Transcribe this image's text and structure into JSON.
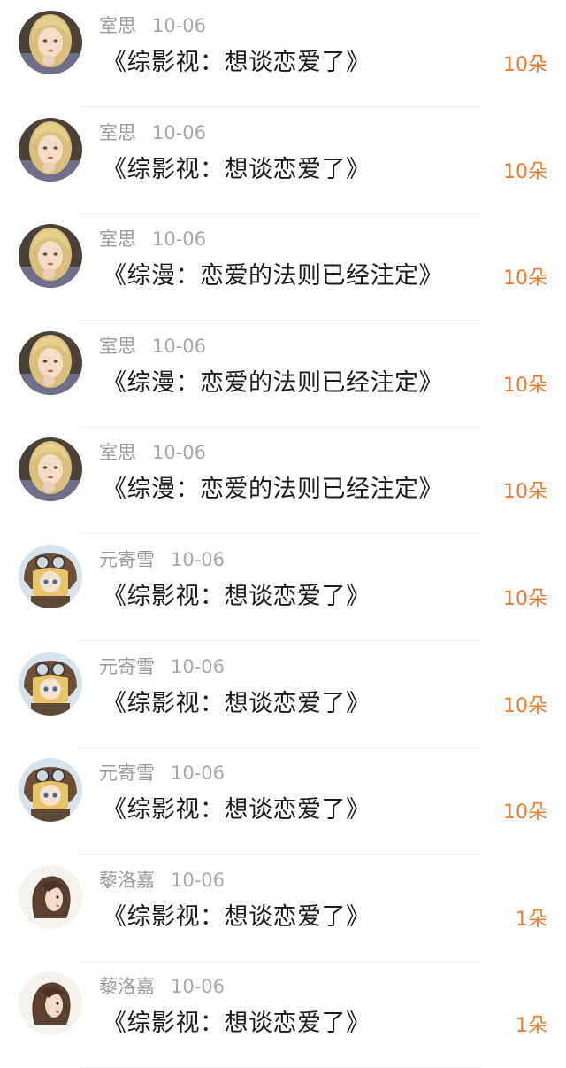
{
  "list": [
    {
      "name": "室思",
      "date": "10-06",
      "title": "《综影视：想谈恋爱了》",
      "gift": "10朵",
      "avatar": "blonde-girl-avatar"
    },
    {
      "name": "室思",
      "date": "10-06",
      "title": "《综影视：想谈恋爱了》",
      "gift": "10朵",
      "avatar": "blonde-girl-avatar"
    },
    {
      "name": "室思",
      "date": "10-06",
      "title": "《综漫：恋爱的法则已经注定》",
      "gift": "10朵",
      "avatar": "blonde-girl-avatar"
    },
    {
      "name": "室思",
      "date": "10-06",
      "title": "《综漫：恋爱的法则已经注定》",
      "gift": "10朵",
      "avatar": "blonde-girl-avatar"
    },
    {
      "name": "室思",
      "date": "10-06",
      "title": "《综漫：恋爱的法则已经注定》",
      "gift": "10朵",
      "avatar": "blonde-girl-avatar"
    },
    {
      "name": "元寄雪",
      "date": "10-06",
      "title": "《综影视：想谈恋爱了》",
      "gift": "10朵",
      "avatar": "aviator-girl-avatar"
    },
    {
      "name": "元寄雪",
      "date": "10-06",
      "title": "《综影视：想谈恋爱了》",
      "gift": "10朵",
      "avatar": "aviator-girl-avatar"
    },
    {
      "name": "元寄雪",
      "date": "10-06",
      "title": "《综影视：想谈恋爱了》",
      "gift": "10朵",
      "avatar": "aviator-girl-avatar"
    },
    {
      "name": "藜洛嘉",
      "date": "10-06",
      "title": "《综影视：想谈恋爱了》",
      "gift": "1朵",
      "avatar": "brunette-girl-avatar"
    },
    {
      "name": "藜洛嘉",
      "date": "10-06",
      "title": "《综影视：想谈恋爱了》",
      "gift": "1朵",
      "avatar": "brunette-girl-avatar"
    }
  ]
}
